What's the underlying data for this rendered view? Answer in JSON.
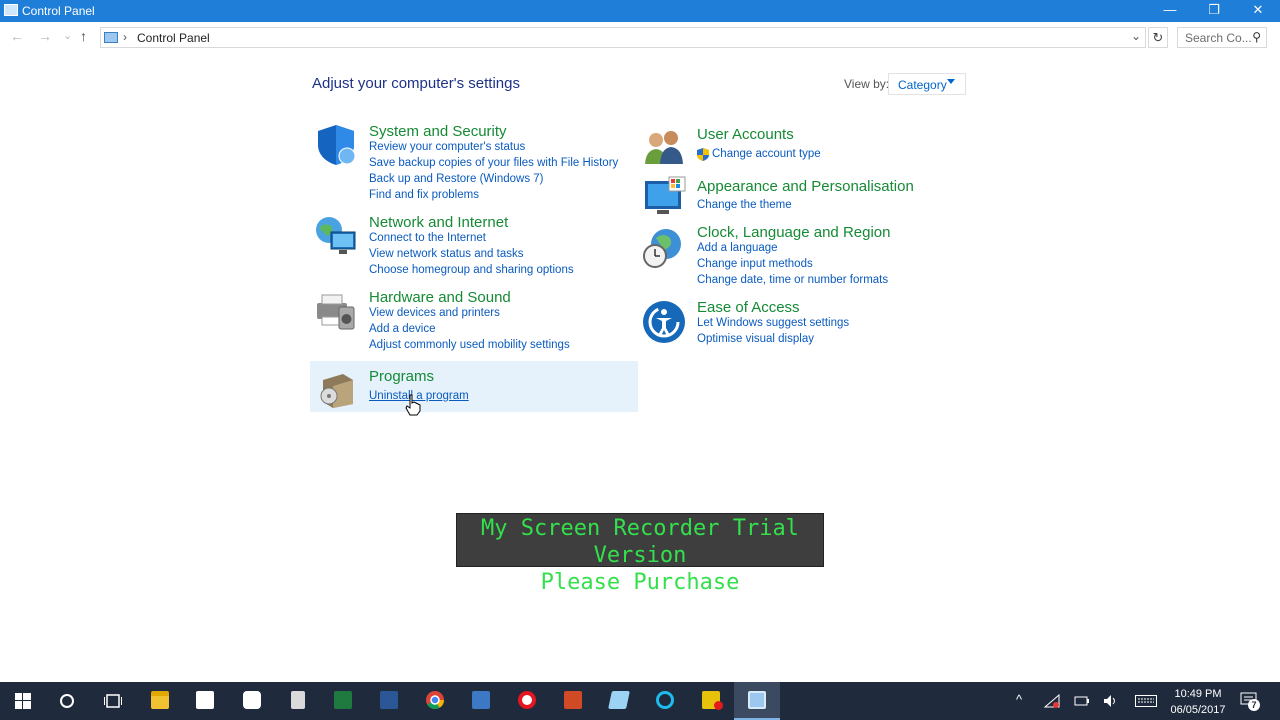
{
  "window": {
    "title": "Control Panel",
    "minimize": "—",
    "restore": "❐",
    "close": "✕"
  },
  "nav": {
    "back": "←",
    "forward": "→",
    "recent": "⌄",
    "up": "↑"
  },
  "address": {
    "separator": "›",
    "crumb": "Control Panel",
    "dropdown": "⌄",
    "refresh": "↻"
  },
  "search": {
    "placeholder": "Search Co...",
    "icon": "⚲"
  },
  "header": {
    "title": "Adjust your computer's settings",
    "view_by_label": "View by:",
    "view_by_value": "Category"
  },
  "categories": {
    "system": {
      "title": "System and Security",
      "links": [
        "Review your computer's status",
        "Save backup copies of your files with File History",
        "Back up and Restore (Windows 7)",
        "Find and fix problems"
      ]
    },
    "network": {
      "title": "Network and Internet",
      "links": [
        "Connect to the Internet",
        "View network status and tasks",
        "Choose homegroup and sharing options"
      ]
    },
    "hardware": {
      "title": "Hardware and Sound",
      "links": [
        "View devices and printers",
        "Add a device",
        "Adjust commonly used mobility settings"
      ]
    },
    "programs": {
      "title": "Programs",
      "links": [
        "Uninstall a program"
      ]
    },
    "users": {
      "title": "User Accounts",
      "links": [
        "Change account type"
      ]
    },
    "appearance": {
      "title": "Appearance and Personalisation",
      "links": [
        "Change the theme"
      ]
    },
    "clock": {
      "title": "Clock, Language and Region",
      "links": [
        "Add a language",
        "Change input methods",
        "Change date, time or number formats"
      ]
    },
    "ease": {
      "title": "Ease of Access",
      "links": [
        "Let Windows suggest settings",
        "Optimise visual display"
      ]
    }
  },
  "watermark": {
    "line1": "My Screen Recorder Trial Version",
    "line2": "Please Purchase"
  },
  "taskbar": {
    "time": "10:49 PM",
    "date": "06/05/2017",
    "notification_count": "7",
    "apps": [
      "start",
      "cortana",
      "task-view",
      "file-explorer",
      "store",
      "camera",
      "calculator",
      "excel",
      "word",
      "chrome",
      "outlook",
      "opera",
      "powerpoint",
      "notepad",
      "internet-explorer",
      "recorder",
      "control-panel"
    ]
  },
  "colors": {
    "titlebar": "#1e7ed8",
    "category_title": "#168a35",
    "link": "#0a5bbf",
    "page_title": "#1e3287",
    "taskbar": "#1f2a3c",
    "watermark_text": "#33e04c"
  }
}
